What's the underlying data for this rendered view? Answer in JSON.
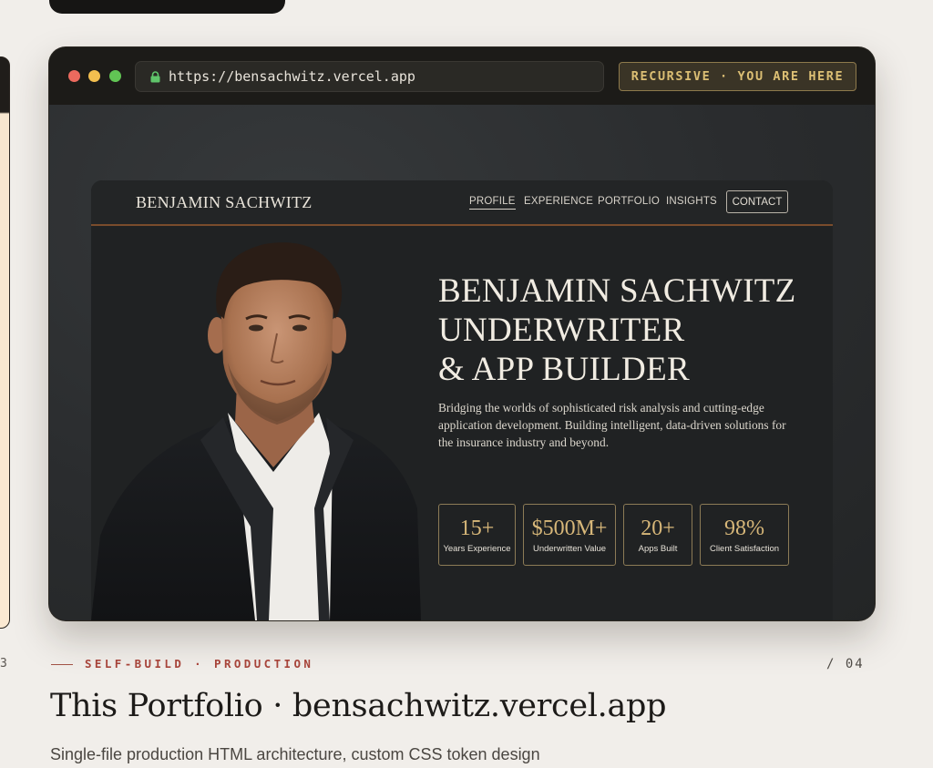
{
  "previous_card": {
    "index_fragment": "3"
  },
  "browser": {
    "url": "https://bensachwitz.vercel.app",
    "badge": "RECURSIVE · YOU ARE HERE"
  },
  "site": {
    "logo": "BENJAMIN SACHWITZ",
    "nav": [
      {
        "label": "PROFILE",
        "active": true
      },
      {
        "label": "EXPERIENCE",
        "active": false
      },
      {
        "label": "PORTFOLIO",
        "active": false
      },
      {
        "label": "INSIGHTS",
        "active": false
      },
      {
        "label": "CONTACT",
        "active": false
      }
    ],
    "hero_title": [
      "BENJAMIN SACHWITZ",
      "UNDERWRITER",
      "& APP BUILDER"
    ],
    "hero_description": "Bridging the worlds of sophisticated risk analysis and cutting-edge application development. Building intelligent, data-driven solutions for the insurance industry and beyond.",
    "stats": [
      {
        "value": "15+",
        "label": "Years Experience"
      },
      {
        "value": "$500M+",
        "label": "Underwritten Value"
      },
      {
        "value": "20+",
        "label": "Apps Built"
      },
      {
        "value": "98%",
        "label": "Client Satisfaction"
      }
    ]
  },
  "card": {
    "tag": "SELF-BUILD · PRODUCTION",
    "index": "/ 04",
    "title": "This Portfolio · bensachwitz.vercel.app",
    "description": "Single-file production HTML architecture, custom CSS token design"
  },
  "colors": {
    "accent_red": "#a7443a",
    "gold": "#d7b779",
    "badge_text": "#dcbf74",
    "page_bg": "#f1eeea"
  }
}
